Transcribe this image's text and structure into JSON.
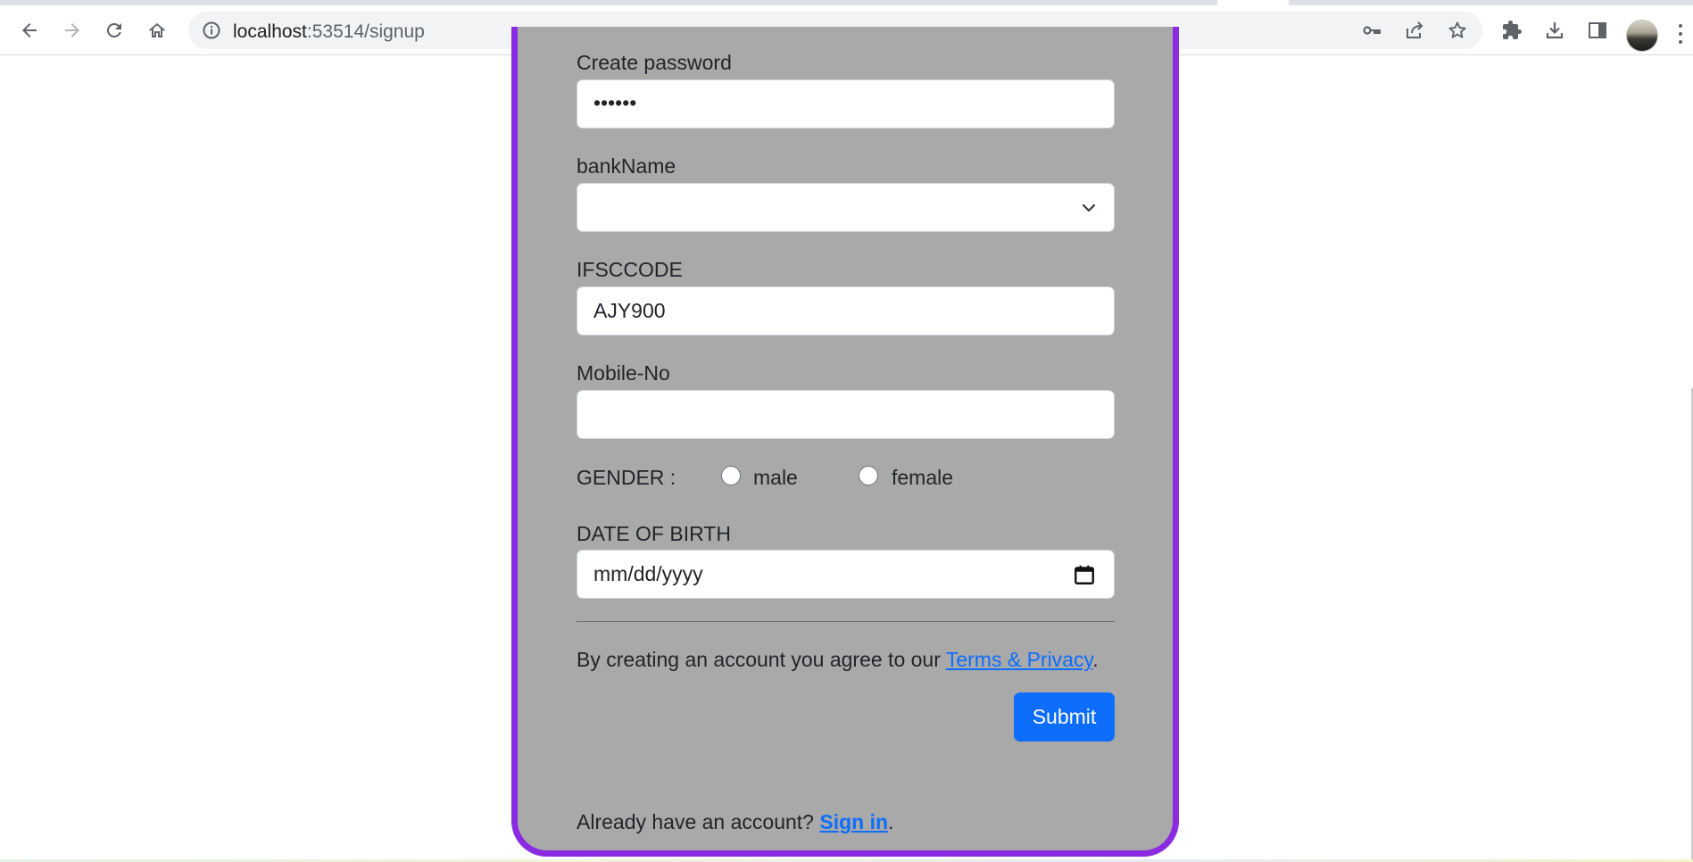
{
  "browser": {
    "url_host": "localhost",
    "url_path": ":53514/signup",
    "icons": {
      "back": "back-arrow-icon",
      "forward": "forward-arrow-icon",
      "reload": "reload-icon",
      "home": "home-icon",
      "info": "info-icon",
      "key": "key-icon",
      "share": "share-icon",
      "bookmark": "star-icon",
      "extensions": "puzzle-icon",
      "downloads": "download-icon",
      "sidepanel": "side-panel-icon",
      "profile": "avatar",
      "menu": "kebab-menu-icon"
    }
  },
  "form": {
    "password": {
      "label": "Create password",
      "value": "••••••"
    },
    "bank": {
      "label": "bankName",
      "value": ""
    },
    "ifsc": {
      "label": "IFSCCODE",
      "value": "AJY900"
    },
    "mobile": {
      "label": "Mobile-No",
      "value": ""
    },
    "gender": {
      "label": "GENDER :",
      "options": [
        "male",
        "female"
      ],
      "selected": null
    },
    "dob": {
      "label": "DATE OF BIRTH",
      "placeholder": "mm/dd/yyyy"
    },
    "terms": {
      "prefix": "By creating an account you agree to our ",
      "link": "Terms & Privacy",
      "suffix": "."
    },
    "submit_label": "Submit",
    "signin": {
      "prefix": "Already have an account? ",
      "link": "Sign in",
      "suffix": "."
    }
  },
  "colors": {
    "card_background": "#a9a9a9",
    "card_border": "#8a2be2",
    "primary": "#0d6efd"
  }
}
